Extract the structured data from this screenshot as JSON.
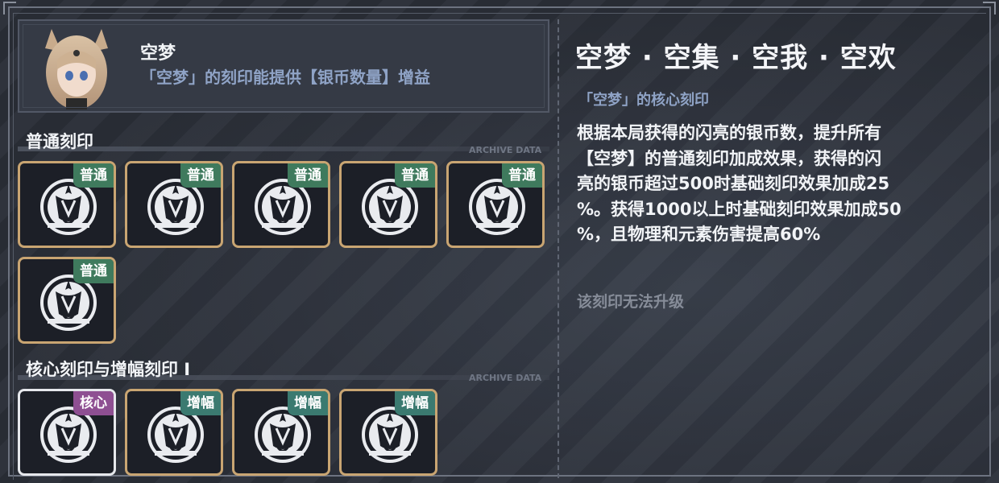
{
  "header": {
    "name": "空梦",
    "description": "「空梦」的刻印能提供【银币数量】增益"
  },
  "sections": [
    {
      "title": "普通刻印",
      "archive_label": "ARCHIVE DATA",
      "tiles": [
        {
          "badge": "普通"
        },
        {
          "badge": "普通"
        },
        {
          "badge": "普通"
        },
        {
          "badge": "普通"
        },
        {
          "badge": "普通"
        },
        {
          "badge": "普通"
        }
      ]
    },
    {
      "title": "核心刻印与增幅刻印 I",
      "archive_label": "ARCHIVE DATA",
      "tiles": [
        {
          "badge": "核心"
        },
        {
          "badge": "增幅"
        },
        {
          "badge": "增幅"
        },
        {
          "badge": "增幅"
        }
      ]
    }
  ],
  "detail": {
    "title": "空梦 · 空集 · 空我 · 空欢",
    "subtitle": "「空梦」的核心刻印",
    "description": "根据本局获得的闪亮的银币数，提升所有\n【空梦】的普通刻印加成效果，获得的闪\n亮的银币超过500时基础刻印效果加成25\n%。获得1000以上时基础刻印效果加成50\n%，且物理和元素伤害提高60%",
    "note": "该刻印无法升级"
  },
  "colors": {
    "normal_badge": "#3f7a5d",
    "core_badge": "#8e4f92",
    "amp_badge": "#3b7a70",
    "tile_border": "#c9a572",
    "accent_text": "#8fa3c6"
  },
  "icons": [
    "character-portrait",
    "emblem-icon"
  ]
}
